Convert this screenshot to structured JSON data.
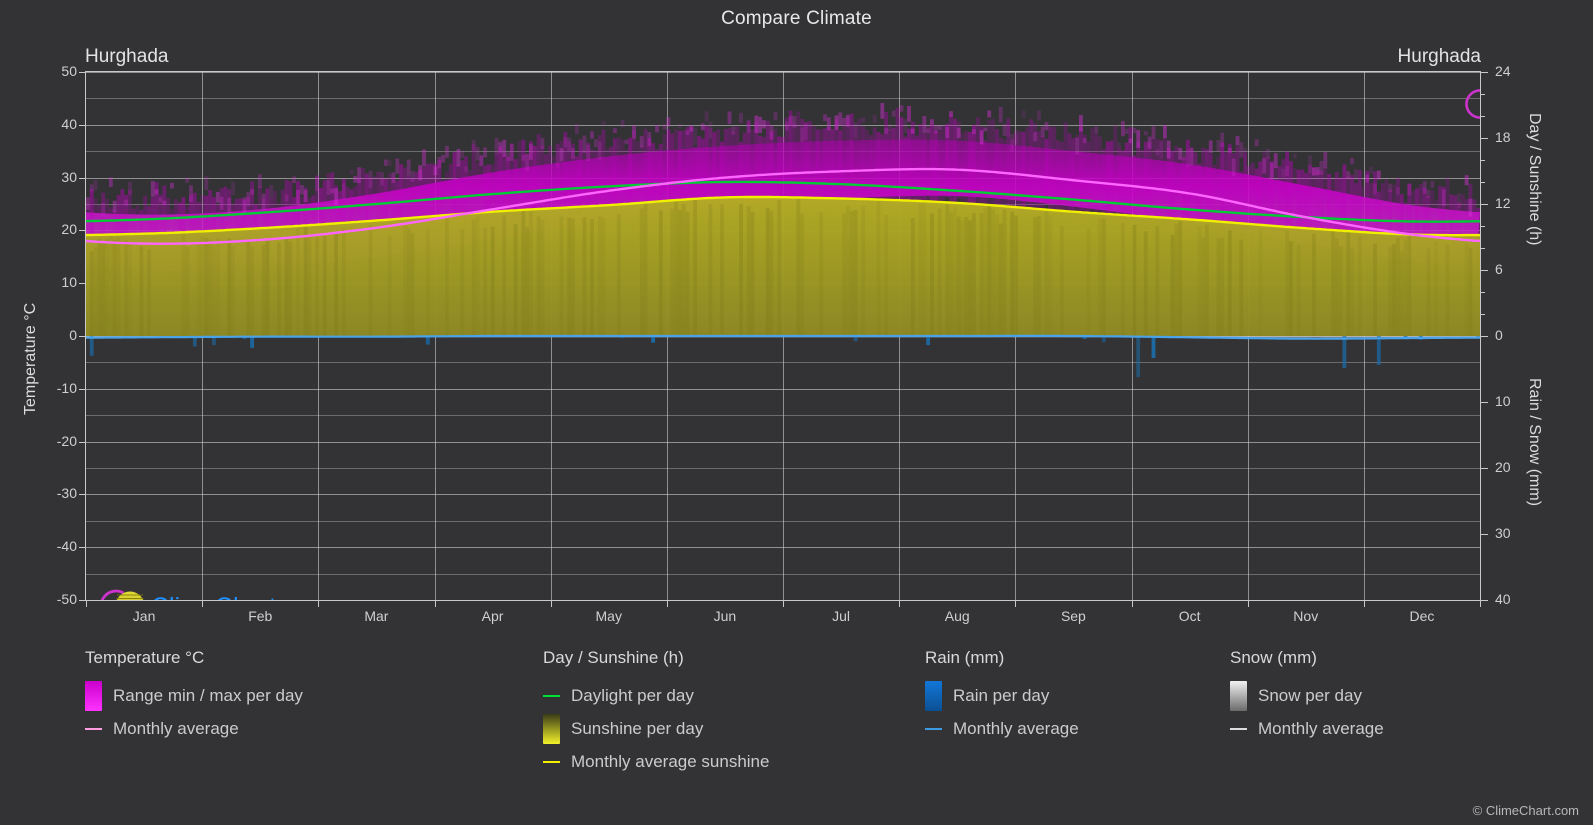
{
  "header": {
    "title": "Compare Climate",
    "city_left": "Hurghada",
    "city_right": "Hurghada"
  },
  "branding": {
    "logo_text": "ClimeChart.com",
    "copyright": "© ClimeChart.com",
    "logo_arc_color": "#cc33cc",
    "logo_sphere_color": "#d4cc22",
    "logo_text_color": "#1e90ff"
  },
  "colors": {
    "background": "#333336",
    "grid": "#c9c9c9",
    "temp_range": "#cc00cc",
    "temp_avg": "#ff66ff",
    "daylight": "#00cc33",
    "sunshine_fill": "#9a9a22",
    "sunshine_avg": "#f0f000",
    "rain": "#1a7fd4",
    "rain_avg": "#4aa3e8",
    "snow": "#e8e8e8"
  },
  "axes": {
    "y_left": {
      "label": "Temperature °C",
      "ticks": [
        "50",
        "40",
        "30",
        "20",
        "10",
        "0",
        "-10",
        "-20",
        "-30",
        "-40",
        "-50"
      ],
      "min": -50,
      "max": 50,
      "step": 10
    },
    "y_right_top": {
      "label": "Day / Sunshine (h)",
      "ticks": [
        "24",
        "18",
        "12",
        "6",
        "0"
      ],
      "min": 0,
      "max": 24,
      "step": 6
    },
    "y_right_bottom": {
      "label": "Rain / Snow (mm)",
      "ticks": [
        "0",
        "10",
        "20",
        "30",
        "40"
      ],
      "min": 0,
      "max": 40,
      "step": 10
    },
    "x": {
      "ticks": [
        "Jan",
        "Feb",
        "Mar",
        "Apr",
        "May",
        "Jun",
        "Jul",
        "Aug",
        "Sep",
        "Oct",
        "Nov",
        "Dec"
      ]
    }
  },
  "legend": {
    "columns": [
      {
        "heading": "Temperature °C",
        "items": [
          {
            "label": "Range min / max per day",
            "marker": "gradient",
            "color": "#cc00cc",
            "color2": "#ff33ff"
          },
          {
            "label": "Monthly average",
            "marker": "line",
            "color": "#ff9de0"
          }
        ]
      },
      {
        "heading": "Day / Sunshine (h)",
        "items": [
          {
            "label": "Daylight per day",
            "marker": "line",
            "color": "#00dd33"
          },
          {
            "label": "Sunshine per day",
            "marker": "gradient",
            "color": "#3a3a18",
            "color2": "#f2f22a"
          },
          {
            "label": "Monthly average sunshine",
            "marker": "line",
            "color": "#f0f000"
          }
        ]
      },
      {
        "heading": "Rain (mm)",
        "items": [
          {
            "label": "Rain per day",
            "marker": "gradient",
            "color": "#1277d8",
            "color2": "#0c4f93"
          },
          {
            "label": "Monthly average",
            "marker": "line",
            "color": "#3e9ae0"
          }
        ]
      },
      {
        "heading": "Snow (mm)",
        "items": [
          {
            "label": "Snow per day",
            "marker": "gradient",
            "color": "#f2f2f2",
            "color2": "#6b6b6b"
          },
          {
            "label": "Monthly average",
            "marker": "line",
            "color": "#dddddd"
          }
        ]
      }
    ]
  },
  "chart_data": {
    "type": "line",
    "title": "Compare Climate",
    "location": "Hurghada",
    "xlabel": "",
    "ylabel": "Temperature °C",
    "ylim": [
      -50,
      50
    ],
    "y2lim_day": [
      0,
      24
    ],
    "y2lim_precip": [
      0,
      40
    ],
    "grid": true,
    "categories": [
      "Jan",
      "Feb",
      "Mar",
      "Apr",
      "May",
      "Jun",
      "Jul",
      "Aug",
      "Sep",
      "Oct",
      "Nov",
      "Dec"
    ],
    "series": [
      {
        "name": "Monthly average",
        "unit": "°C",
        "axis": "temperature",
        "color": "#ff9de0",
        "values": [
          17.5,
          18.2,
          20.5,
          24.0,
          27.5,
          30.0,
          31.2,
          31.5,
          29.5,
          27.0,
          22.5,
          19.0
        ]
      },
      {
        "name": "Range max per day",
        "unit": "°C",
        "axis": "temperature",
        "color": "#cc00cc",
        "values": [
          23.0,
          24.0,
          27.0,
          31.0,
          34.0,
          36.0,
          37.0,
          37.0,
          35.0,
          32.5,
          28.5,
          24.5
        ]
      },
      {
        "name": "Range min per day",
        "unit": "°C",
        "axis": "temperature",
        "color": "#cc00cc",
        "values": [
          12.5,
          13.0,
          15.0,
          18.5,
          22.0,
          24.5,
          26.0,
          26.5,
          24.5,
          21.5,
          17.5,
          14.0
        ]
      },
      {
        "name": "Daylight per day",
        "unit": "h",
        "axis": "day",
        "color": "#00dd33",
        "values": [
          10.6,
          11.2,
          12.0,
          12.9,
          13.6,
          14.0,
          13.8,
          13.2,
          12.4,
          11.5,
          10.8,
          10.4
        ]
      },
      {
        "name": "Monthly average sunshine",
        "unit": "h",
        "axis": "day",
        "color": "#f0f000",
        "values": [
          9.3,
          9.8,
          10.5,
          11.3,
          11.9,
          12.6,
          12.5,
          12.1,
          11.3,
          10.6,
          9.8,
          9.2
        ]
      },
      {
        "name": "Rain monthly average",
        "unit": "mm",
        "axis": "precipitation",
        "color": "#4aa3e8",
        "values": [
          0.2,
          0.1,
          0.1,
          0.0,
          0.0,
          0.0,
          0.0,
          0.0,
          0.0,
          0.2,
          0.4,
          0.3
        ]
      },
      {
        "name": "Snow monthly average",
        "unit": "mm",
        "axis": "precipitation",
        "color": "#dddddd",
        "values": [
          0,
          0,
          0,
          0,
          0,
          0,
          0,
          0,
          0,
          0,
          0,
          0
        ]
      }
    ]
  }
}
